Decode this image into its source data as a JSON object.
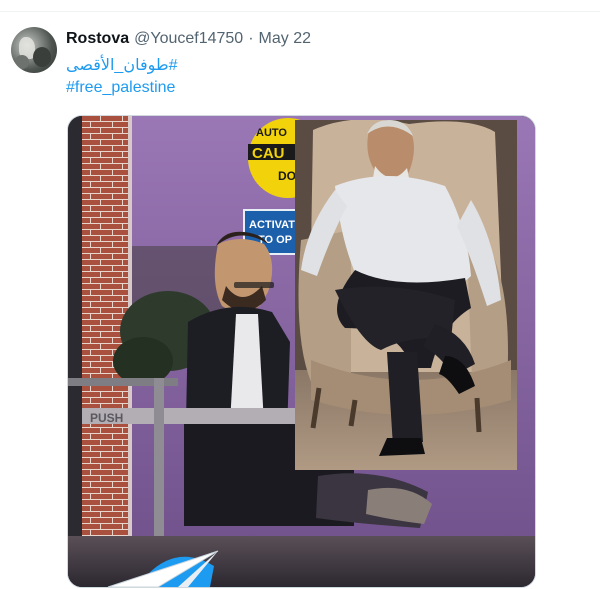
{
  "tweet": {
    "author_name": "Rostova",
    "author_handle": "@Youcef14750",
    "separator": "·",
    "date": "May 22",
    "hashtags": [
      "#طوفان_الأقصى",
      "#free_palestine"
    ]
  },
  "media": {
    "sign_text": [
      "AUTO",
      "CAU",
      "DO",
      "ACTIVAT",
      "TO OP"
    ],
    "rail_text": "PUSH"
  },
  "colors": {
    "link": "#1d9bf0",
    "name": "#0f1419",
    "secondary": "#536471",
    "divider": "#eff3f4",
    "sign_yellow": "#f5d60a",
    "sign_blue": "#1c5faa",
    "brick": "#b0584a",
    "wall_purple": "#8e6aa8"
  }
}
